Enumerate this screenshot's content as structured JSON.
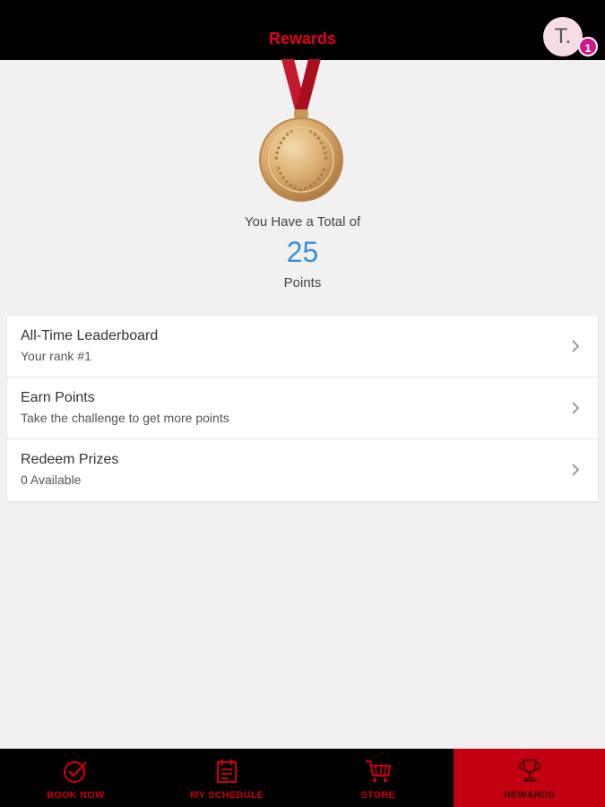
{
  "header": {
    "title": "Rewards",
    "avatar_initial": "T.",
    "notification_count": "1"
  },
  "summary": {
    "total_label": "You Have a Total of",
    "points": "25",
    "points_label": "Points"
  },
  "menu": {
    "items": [
      {
        "title": "All-Time Leaderboard",
        "subtitle": "Your rank #1"
      },
      {
        "title": "Earn Points",
        "subtitle": "Take the challenge to get more points"
      },
      {
        "title": "Redeem Prizes",
        "subtitle": "0 Available"
      }
    ]
  },
  "tabbar": {
    "tabs": [
      {
        "label": "BOOK NOW",
        "icon": "check-circle-icon"
      },
      {
        "label": "MY SCHEDULE",
        "icon": "calendar-icon"
      },
      {
        "label": "STORE",
        "icon": "cart-icon"
      },
      {
        "label": "REWARDS",
        "icon": "trophy-icon",
        "active": true
      }
    ]
  },
  "colors": {
    "brand_red": "#e3001b",
    "active_tab": "#c2000f",
    "points_blue": "#3b8fd8",
    "badge": "#d1168f"
  }
}
